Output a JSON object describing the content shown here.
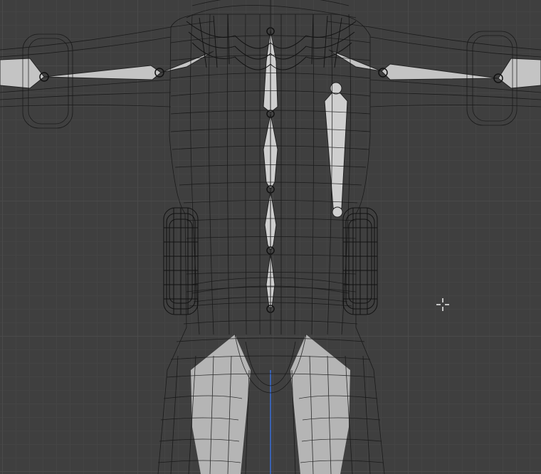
{
  "viewport": {
    "mode": "wireframe",
    "background": "#3f3f3f",
    "grid_color": "#4a4a4a",
    "wire_color": "#111111",
    "bone_color": "#c8c8c8",
    "z_axis_color": "#3a6fd6"
  },
  "scene": {
    "object": "character-mesh",
    "armature": "armature-bones",
    "cursor_icon": "3d-cursor-crosshair-icon"
  }
}
